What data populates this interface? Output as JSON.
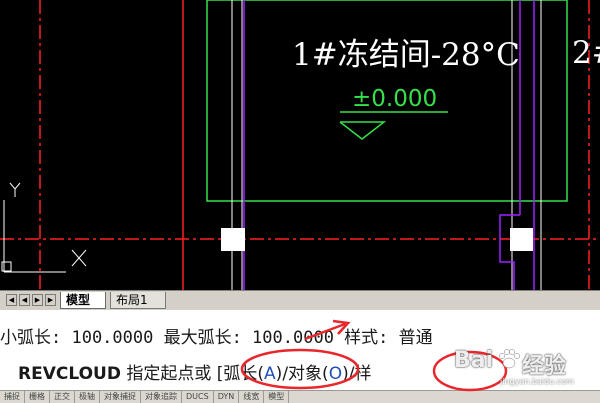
{
  "drawing": {
    "room_label": "1#冻结间-28°C",
    "room_label_right": "2#",
    "elevation_label": "±0.000",
    "colors": {
      "background": "#000000",
      "wall": "#35e04a",
      "grid": "#ff2020",
      "column": "#a020ff",
      "white": "#ffffff"
    }
  },
  "layout_tabs": {
    "model": "模型",
    "layout1": "布局1"
  },
  "command": {
    "line1": "小弧长: 100.0000   最大弧长: 100.0000   样式: 普通",
    "line2_cmd": "REVCLOUD",
    "line2_prompt": "指定起点或 [",
    "opt_arc_label": "弧长(",
    "opt_arc_key": "A",
    "opt_arc_close": ")",
    "opt_obj_label": "/对象(",
    "opt_obj_key": "O",
    "opt_obj_close": ")",
    "opt_style_label": "/样"
  },
  "status_bar": [
    "捕捉",
    "栅格",
    "正交",
    "极轴",
    "对象捕捉",
    "对象追踪",
    "DUCS",
    "DYN",
    "线宽",
    "模型"
  ],
  "watermark": {
    "brand": "Bai",
    "brand2": "经验",
    "site": "jingyan.baidu.com"
  },
  "annotation_color": "#e8262b"
}
